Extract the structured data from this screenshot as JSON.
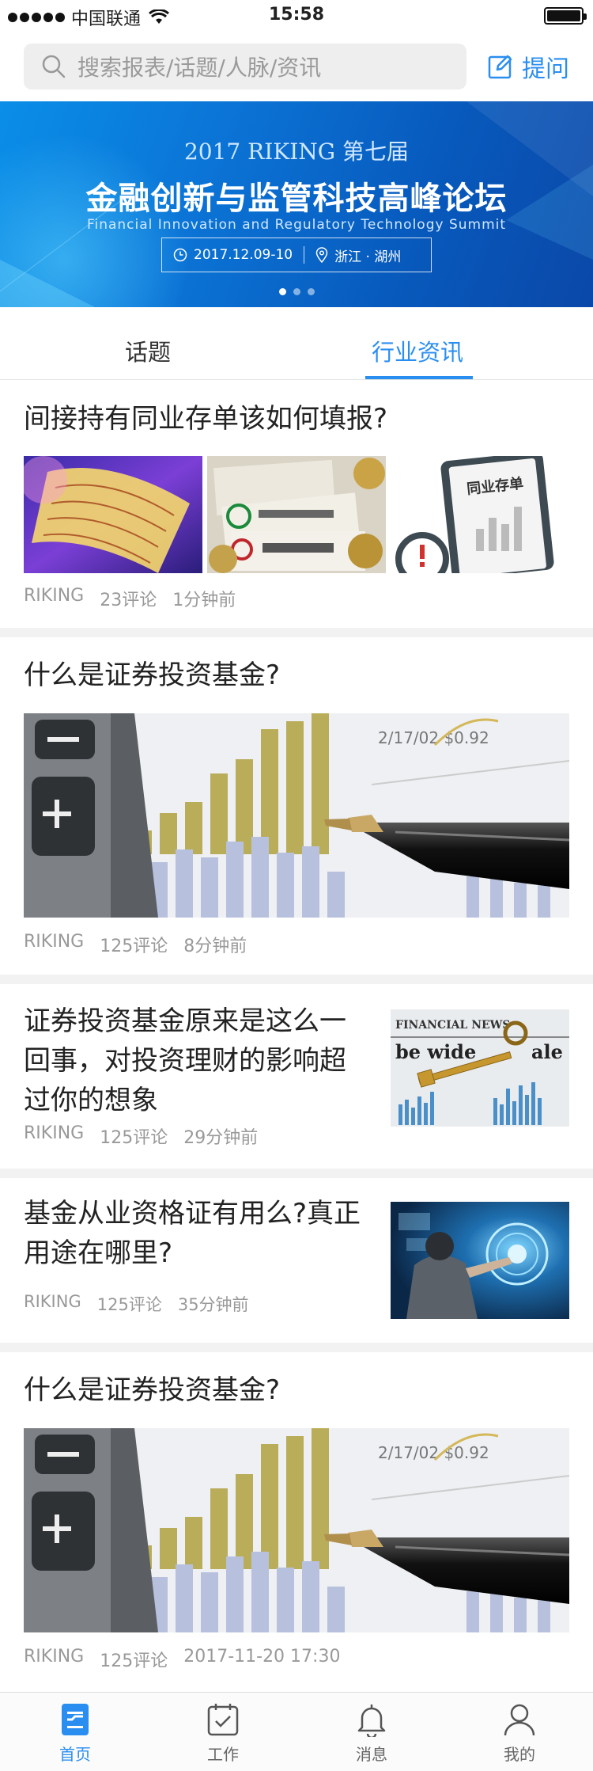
{
  "status_bar": {
    "carrier": "中国联通",
    "time": "15:58"
  },
  "search": {
    "placeholder": "搜索报表/话题/人脉/资讯",
    "ask_label": "提问"
  },
  "banner": {
    "year_line": "2017 RIKING 第七届",
    "title": "金融创新与监管科技高峰论坛",
    "subtitle": "Financial Innovation and Regulatory Technology Summit",
    "date": "2017.12.09-10",
    "location": "浙江 · 湖州",
    "slides": 3,
    "active_slide": 1
  },
  "tabs": [
    {
      "label": "话题",
      "active": false
    },
    {
      "label": "行业资讯",
      "active": true
    }
  ],
  "articles": [
    {
      "title": "间接持有同业存单该如何填报?",
      "source": "RIKING",
      "comments": "23评论",
      "time": "1分钟前",
      "image_text": "同业存单"
    },
    {
      "title": "什么是证券投资基金?",
      "source": "RIKING",
      "comments": "125评论",
      "time": "8分钟前",
      "image_text": "2/17/02 $0.92"
    },
    {
      "title": "证券投资基金原来是这么一回事，对投资理财的影响超过你的想象",
      "source": "RIKING",
      "comments": "125评论",
      "time": "29分钟前",
      "image_text": "FINANCIAL NEWS"
    },
    {
      "title": "基金从业资格证有用么?真正用途在哪里?",
      "source": "RIKING",
      "comments": "125评论",
      "time": "35分钟前"
    },
    {
      "title": "什么是证券投资基金?",
      "source": "RIKING",
      "comments": "125评论",
      "time": "2017-11-20 17:30",
      "image_text": "2/17/02 $0.92"
    }
  ],
  "nav": [
    {
      "label": "首页",
      "icon": "home-doc-icon",
      "active": true
    },
    {
      "label": "工作",
      "icon": "calendar-check-icon",
      "active": false
    },
    {
      "label": "消息",
      "icon": "bell-icon",
      "active": false
    },
    {
      "label": "我的",
      "icon": "user-icon",
      "active": false
    }
  ],
  "colors": {
    "accent": "#2a8ef0",
    "banner": "#0b74d6",
    "divider": "#f2f2f2"
  }
}
